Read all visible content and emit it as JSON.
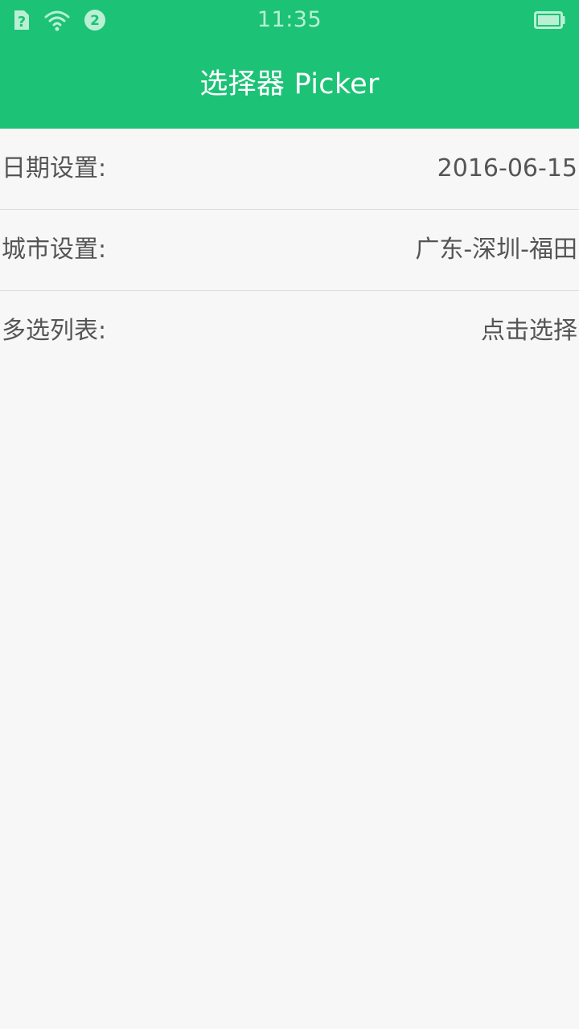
{
  "status_bar": {
    "time": "11:35",
    "notification_count": "2",
    "sim_icon": "sim-question-icon",
    "wifi_icon": "wifi-icon",
    "battery_icon": "battery-icon"
  },
  "header": {
    "title": "选择器 Picker",
    "background_color": "#1cc276"
  },
  "settings": [
    {
      "label": "日期设置:",
      "value": "2016-06-15"
    },
    {
      "label": "城市设置:",
      "value": "广东-深圳-福田"
    },
    {
      "label": "多选列表:",
      "value": "点击选择"
    }
  ]
}
